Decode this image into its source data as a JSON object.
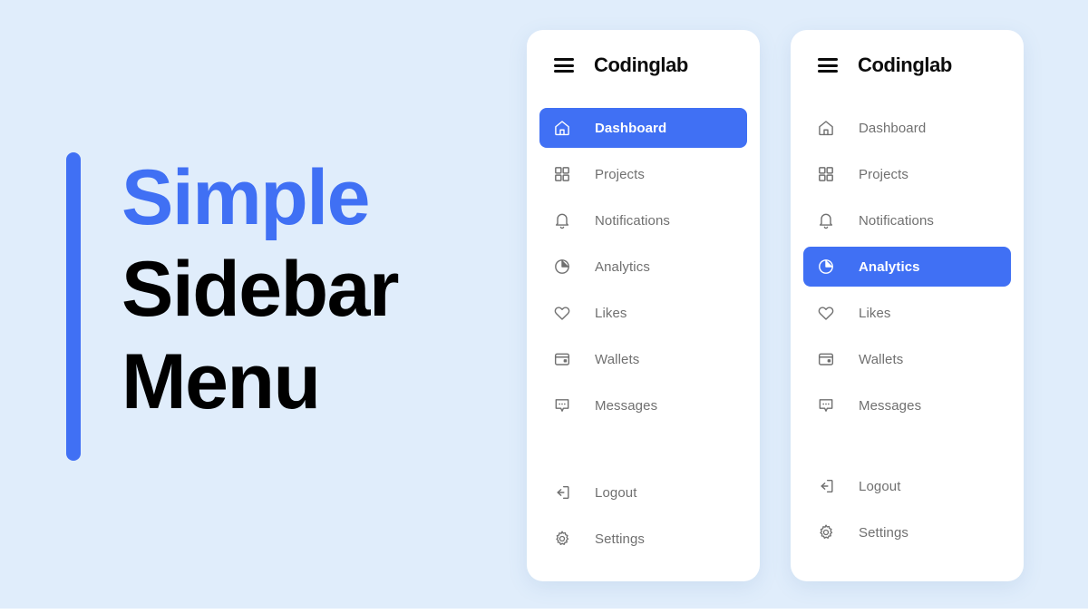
{
  "theme": {
    "background": "#e0edfb",
    "accent_blue": "#4070f4",
    "card_background": "#ffffff",
    "muted_text": "#707070",
    "heading_text": "#000000"
  },
  "hero": {
    "lines": [
      {
        "text": "Simple",
        "color": "accent"
      },
      {
        "text": "Sidebar",
        "color": "dark"
      },
      {
        "text": "Menu",
        "color": "dark"
      }
    ]
  },
  "sidebars": [
    {
      "id": "sidebar-one",
      "brand": "Codinglab",
      "menu_icon": "hamburger-icon",
      "items": [
        {
          "label": "Dashboard",
          "icon": "home-icon",
          "active": true
        },
        {
          "label": "Projects",
          "icon": "grid-icon",
          "active": false
        },
        {
          "label": "Notifications",
          "icon": "bell-icon",
          "active": false
        },
        {
          "label": "Analytics",
          "icon": "pie-chart-icon",
          "active": false
        },
        {
          "label": "Likes",
          "icon": "heart-icon",
          "active": false
        },
        {
          "label": "Wallets",
          "icon": "wallet-icon",
          "active": false
        },
        {
          "label": "Messages",
          "icon": "chat-bubble-icon",
          "active": false
        }
      ],
      "bottom_items": [
        {
          "label": "Logout",
          "icon": "logout-icon",
          "active": false
        },
        {
          "label": "Settings",
          "icon": "gear-icon",
          "active": false
        }
      ]
    },
    {
      "id": "sidebar-two",
      "brand": "Codinglab",
      "menu_icon": "hamburger-icon",
      "items": [
        {
          "label": "Dashboard",
          "icon": "home-icon",
          "active": false
        },
        {
          "label": "Projects",
          "icon": "grid-icon",
          "active": false
        },
        {
          "label": "Notifications",
          "icon": "bell-icon",
          "active": false
        },
        {
          "label": "Analytics",
          "icon": "pie-chart-icon",
          "active": true
        },
        {
          "label": "Likes",
          "icon": "heart-icon",
          "active": false
        },
        {
          "label": "Wallets",
          "icon": "wallet-icon",
          "active": false
        },
        {
          "label": "Messages",
          "icon": "chat-bubble-icon",
          "active": false
        }
      ],
      "bottom_items": [
        {
          "label": "Logout",
          "icon": "logout-icon",
          "active": false
        },
        {
          "label": "Settings",
          "icon": "gear-icon",
          "active": false
        }
      ]
    }
  ]
}
